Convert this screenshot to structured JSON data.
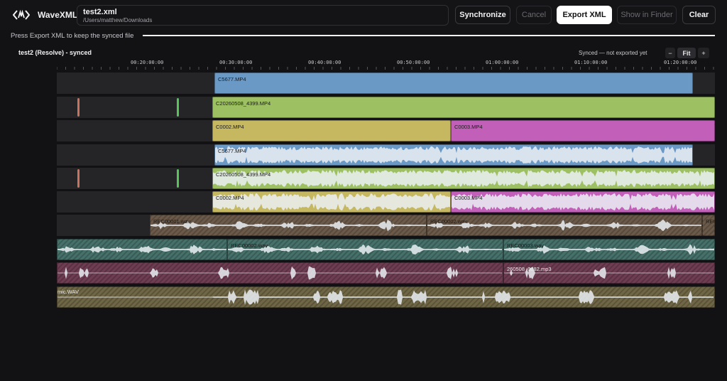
{
  "app": {
    "name": "WaveXML",
    "icon": "wavexml-logo-icon"
  },
  "file": {
    "name": "test2.xml",
    "path": "/Users/matthew/Downloads"
  },
  "buttons": {
    "synchronize": "Synchronize",
    "cancel": "Cancel",
    "export": "Export XML",
    "show_in_finder": "Show in Finder",
    "clear": "Clear"
  },
  "hint": "Press Export XML to keep the synced file",
  "timeline": {
    "title": "test2 (Resolve) - synced",
    "status": "Synced — not exported yet",
    "zoom": {
      "minus": "−",
      "fit": "Fit",
      "plus": "+"
    },
    "ticks": [
      "00:20:00:00",
      "00:30:00:00",
      "00:40:00:00",
      "00:50:00:00",
      "01:00:00:00",
      "01:10:00:00",
      "01:20:00:00"
    ]
  },
  "tracks": [
    {
      "type": "video",
      "clips": [
        {
          "label": "C5677.MP4",
          "color": "#6a99c6"
        }
      ]
    },
    {
      "type": "video",
      "clips": [
        {
          "label": "C20260508_4399.MP4",
          "color": "#9cc062"
        }
      ]
    },
    {
      "type": "video",
      "clips": [
        {
          "label": "C0002.MP4",
          "color": "#c5b860"
        },
        {
          "label": "C0003.MP4",
          "color": "#c25fb8"
        }
      ]
    },
    {
      "type": "audio",
      "clips": [
        {
          "label": "C5677.MP4",
          "color": "#6a99c6"
        }
      ]
    },
    {
      "type": "audio",
      "clips": [
        {
          "label": "C20260508_4399.MP4",
          "color": "#9cc062"
        }
      ]
    },
    {
      "type": "audio",
      "clips": [
        {
          "label": "C0002.MP4",
          "color": "#c5b860"
        },
        {
          "label": "C0003.MP4",
          "color": "#c25fb8"
        }
      ]
    },
    {
      "type": "audio",
      "clips": [
        {
          "label": "REC00001.wav",
          "color": "#6b5a4a"
        },
        {
          "label": "REC00002.wav",
          "color": "#6b5a4a"
        },
        {
          "label": "REC",
          "color": "#6b5a4a"
        }
      ]
    },
    {
      "type": "audio",
      "clips": [
        {
          "label": "",
          "color": "#46706a"
        },
        {
          "label": "REC00002.wav",
          "color": "#46706a"
        },
        {
          "label": "REC00003.wav",
          "color": "#46706a"
        }
      ]
    },
    {
      "type": "audio",
      "clips": [
        {
          "label": "",
          "color": "#6e3d52"
        },
        {
          "label": "260508_0082.mp3",
          "color": "#6e3d52"
        }
      ]
    },
    {
      "type": "audio",
      "clips": [
        {
          "label": "mic.WAV",
          "color": "#6f6646"
        }
      ]
    }
  ],
  "marker_colors": {
    "red": "#c9735e",
    "green": "#57c45c"
  }
}
